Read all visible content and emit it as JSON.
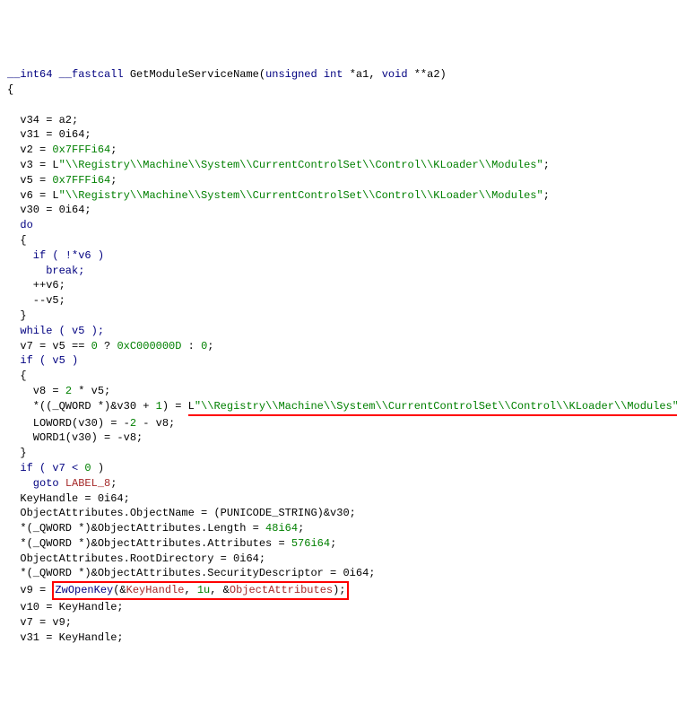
{
  "sig": {
    "type": "__int64",
    "cc": "__fastcall",
    "fn": "GetModuleServiceName",
    "p1t": "unsigned int",
    "p1n": "*a1",
    "p2t": "void",
    "p2n": "**a2"
  },
  "regpath": "\"\\\\Registry\\\\Machine\\\\System\\\\CurrentControlSet\\\\Control\\\\KLoader\\\\Modules\"",
  "l1": "  v34 = a2;",
  "l2": "  v31 = 0i64;",
  "l3a": "  v2 = ",
  "l3b": "0x7FFFi64",
  "l4a": "  v3 = ",
  "l5a": "  v5 = ",
  "l5b": "0x7FFFi64",
  "l6a": "  v6 = ",
  "l7": "  v30 = 0i64;",
  "do": "  do",
  "ob": "  {",
  "ifv6": "    if ( !*v6 )",
  "break": "      break;",
  "incv6": "    ++v6;",
  "decv5": "    --v5;",
  "cb": "  }",
  "whilev5": "  while ( v5 );",
  "l8a": "  v7 = v5 == ",
  "l8b": "0",
  "l8c": " ? ",
  "l8d": "0xC000000D",
  "l8e": " : ",
  "l8f": "0",
  "ifv5": "  if ( v5 )",
  "ob2": "  {",
  "l9a": "    v8 = ",
  "l9b": "2",
  "l9c": " * v5;",
  "l10a": "    *((_QWORD *)&v30 + ",
  "l10b": "1",
  "l10c": ") = ",
  "l11a": "    LOWORD(v30) = -",
  "l11b": "2",
  "l11c": " - v8;",
  "l12": "    WORD1(v30) = -v8;",
  "cb2": "  }",
  "ifv7": "  if ( v7 < ",
  "l13b": ")",
  "goto": "    goto ",
  "label8": "LABEL_8",
  "l14": "  KeyHandle = 0i64;",
  "l15": "  ObjectAttributes.ObjectName = (PUNICODE_STRING)&v30;",
  "l16a": "  *(_QWORD *)&ObjectAttributes.Length = ",
  "l16b": "48i64",
  "l17a": "  *(_QWORD *)&ObjectAttributes.Attributes = ",
  "l17b": "576i64",
  "l18": "  ObjectAttributes.RootDirectory = 0i64;",
  "l19": "  *(_QWORD *)&ObjectAttributes.SecurityDescriptor = 0i64;",
  "l20a": "  v9 = ",
  "zwopen": "ZwOpenKey",
  "l20b": "(&",
  "keyh": "KeyHandle",
  "l20c": ", ",
  "l20d": "1u",
  "l20e": ", &",
  "objattr": "ObjectAttributes",
  "l20f": ");",
  "l21": "  v10 = KeyHandle;",
  "l22": "  v7 = v9;",
  "l23": "  v31 = KeyHandle;",
  "Lpre": "L",
  "semi": ";",
  "zero": "0"
}
